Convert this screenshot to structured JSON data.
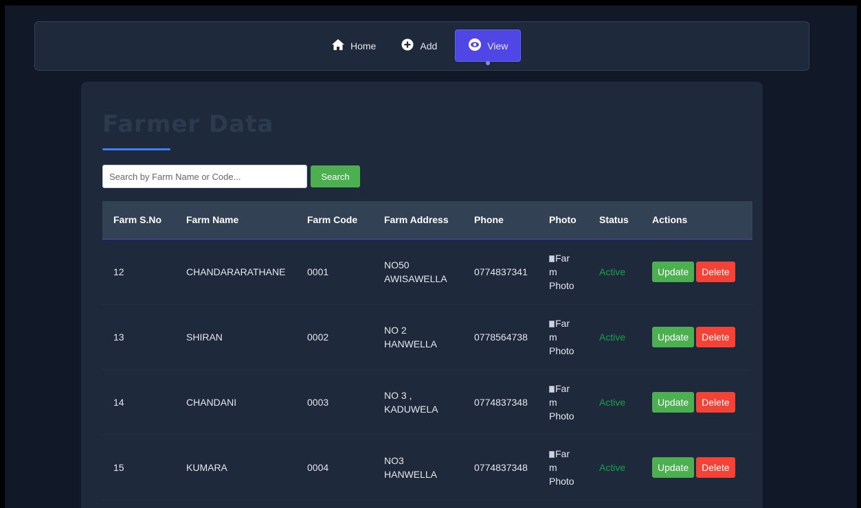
{
  "nav": {
    "items": [
      {
        "label": "Home",
        "icon": "home-icon"
      },
      {
        "label": "Add",
        "icon": "plus-circle-icon"
      },
      {
        "label": "View",
        "icon": "eye-icon",
        "active": true
      }
    ],
    "active_color": "#4f46e5"
  },
  "page": {
    "title": "Farmer Data"
  },
  "search": {
    "placeholder": "Search by Farm Name or Code...",
    "value": "",
    "button_label": "Search"
  },
  "table": {
    "columns": [
      "Farm S.No",
      "Farm Name",
      "Farm Code",
      "Farm Address",
      "Phone",
      "Photo",
      "Status",
      "Actions"
    ],
    "rows": [
      {
        "sno": "12",
        "name": "CHANDARARATHANE",
        "code": "0001",
        "address_line1": "NO50",
        "address_line2": "AWISAWELLA",
        "phone": "0774837341",
        "photo_alt": [
          "Far",
          "m",
          "Photo"
        ],
        "status": "Active"
      },
      {
        "sno": "13",
        "name": "SHIRAN",
        "code": "0002",
        "address_line1": "NO 2",
        "address_line2": "HANWELLA",
        "phone": "0778564738",
        "photo_alt": [
          "Far",
          "m",
          "Photo"
        ],
        "status": "Active"
      },
      {
        "sno": "14",
        "name": "CHANDANI",
        "code": "0003",
        "address_line1": "NO 3 ,",
        "address_line2": "KADUWELA",
        "phone": "0774837348",
        "photo_alt": [
          "Far",
          "m",
          "Photo"
        ],
        "status": "Active"
      },
      {
        "sno": "15",
        "name": "KUMARA",
        "code": "0004",
        "address_line1": "NO3",
        "address_line2": "HANWELLA",
        "phone": "0774837348",
        "photo_alt": [
          "Far",
          "m",
          "Photo"
        ],
        "status": "Active"
      }
    ],
    "actions": {
      "update_label": "Update",
      "delete_label": "Delete"
    }
  },
  "colors": {
    "background": "#111827",
    "card": "#1e293b",
    "header_row": "#334155",
    "update": "#4caf50",
    "delete": "#f44336",
    "status_active": "#16a34a",
    "title_underline": "#3b82f6"
  }
}
